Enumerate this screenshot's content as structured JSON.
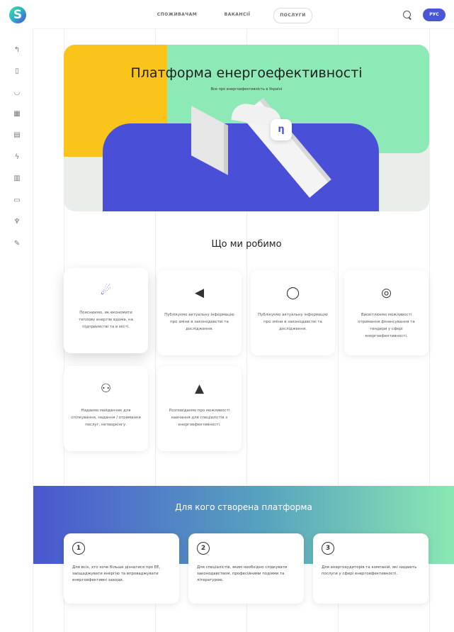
{
  "header": {
    "nav": [
      "СПОЖИВАЧАМ",
      "ВАКАНСІЇ",
      "ПОСЛУГИ"
    ],
    "active_nav": "ПОСЛУГИ",
    "search_icon": "search-icon",
    "lang_label": "РУС"
  },
  "sidebar": {
    "items": [
      {
        "icon": "home-icon",
        "glyph": "↰"
      },
      {
        "icon": "document-icon",
        "glyph": "▯"
      },
      {
        "icon": "bulb-icon",
        "glyph": "◡"
      },
      {
        "icon": "calendar-icon",
        "glyph": "▦"
      },
      {
        "icon": "tasks-icon",
        "glyph": "▤"
      },
      {
        "icon": "lightning-icon",
        "glyph": "ϟ"
      },
      {
        "icon": "trash-icon",
        "glyph": "▥"
      },
      {
        "icon": "briefcase-icon",
        "glyph": "▭"
      },
      {
        "icon": "trophy-icon",
        "glyph": "♆"
      },
      {
        "icon": "pen-icon",
        "glyph": "✎"
      }
    ]
  },
  "hero": {
    "title": "Платформа енергоефективності",
    "subtitle": "Все про енергоефективність в Україні",
    "badge": "η"
  },
  "what_we_do": {
    "title": "Що ми робимо",
    "cards": [
      {
        "icon": "hand-money-icon",
        "glyph": "☄",
        "text": "Пояснюємо, як економити теплову енергію вдома, на підприємстві та в місті."
      },
      {
        "icon": "megaphone-icon",
        "glyph": "◀",
        "text": "Публікуємо актуальну інформацію про зміни в законодавстві та дослідження."
      },
      {
        "icon": "chat-icon",
        "glyph": "◯",
        "text": "Публікуємо актуальну інформацію про зміни в законодавстві та дослідження."
      },
      {
        "icon": "coins-icon",
        "glyph": "◎",
        "text": "Висвітлюємо можливості отримання фінансування та тендери у сфері енергоефективності."
      },
      {
        "icon": "people-icon",
        "glyph": "⚇",
        "text": "Надаємо майданчик для спілкування, надання / отримання послуг, нетворкінгу."
      },
      {
        "icon": "graduation-cap-icon",
        "glyph": "▲",
        "text": "Розповідаємо про можливості навчання для спеціалістів з енергоефективності."
      }
    ]
  },
  "for_whom": {
    "title": "Для кого створена платформа",
    "cards": [
      {
        "num": "1",
        "text": "Для всіх, хто хоче більше дізнатися про ЕЕ, заощаджувати енергію та впроваджувати енергоефективні заходи."
      },
      {
        "num": "2",
        "text": "Для спеціалістів, яким необхідно слідкувати законодавством, професійними подіями та літературою."
      },
      {
        "num": "3",
        "text": "Для енергоаудиторів та компаній, які надають послуги у сфері енергоефективності."
      }
    ]
  },
  "colors": {
    "accent_blue": "#4a4fd8",
    "green": "#8de9b5",
    "yellow": "#fbc41b"
  }
}
